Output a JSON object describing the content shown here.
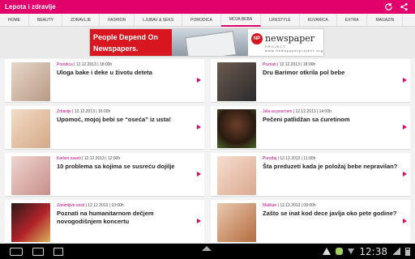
{
  "app": {
    "title": "Lepota i zdravlje"
  },
  "icons": {
    "refresh": "refresh-icon",
    "share": "share-icon"
  },
  "nav": {
    "items": [
      "HOME",
      "BEAUTY",
      "ZDRAVLJE",
      "FASHION",
      "LJUBAV & SEKS",
      "PORODICA",
      "MOJA BEBA",
      "LIFESTYLE",
      "KUVARICA",
      "EXTRA",
      "MAGAZIN"
    ],
    "active": "MOJA BEBA"
  },
  "banner": {
    "left": "People Depend On Newspapers.",
    "logo": "NP",
    "name": "newspaper",
    "sub": "PROJECT",
    "url": "www.newspaperproject.org"
  },
  "articles": [
    {
      "cat": "Porodica",
      "date": "12.12.2013",
      "time": "18:00h",
      "title": "Uloga bake i deke u životu deteta"
    },
    {
      "cat": "Poznati",
      "date": "12.12.2013",
      "time": "18:00h",
      "title": "Dru Barimor otkrila pol bebe"
    },
    {
      "cat": "Zdravlje",
      "date": "12.12.2013",
      "time": "16:00h",
      "title": "Upomoć, mojoj bebi se “oseća” iz usta!"
    },
    {
      "cat": "Jela sa povrćem",
      "date": "12.12.2013",
      "time": "14:00h",
      "title": "Pečeni patlidžan sa ćuretinom"
    },
    {
      "cat": "Korisni saveti",
      "date": "12.12.2013",
      "time": "12:00h",
      "title": "10 problema sa kojima se susreću dojilje"
    },
    {
      "cat": "Porođaj",
      "date": "12.12.2013",
      "time": "11:00h",
      "title": "Šta preduzeti kada je položaj bebe nepravilan?"
    },
    {
      "cat": "Zanimljive vesti",
      "date": "12.12.2013",
      "time": "10:00h",
      "title": "Poznati na humanitarnom dečjem novogodišnjem koncertu"
    },
    {
      "cat": "Mališan",
      "date": "12.12.2013",
      "time": "09:00h",
      "title": "Zašto se inat kod dece javlja oko pete godine?"
    }
  ],
  "status": {
    "time": "12:38"
  },
  "colors": {
    "accent": "#e2006b",
    "category": "#c0007a"
  }
}
